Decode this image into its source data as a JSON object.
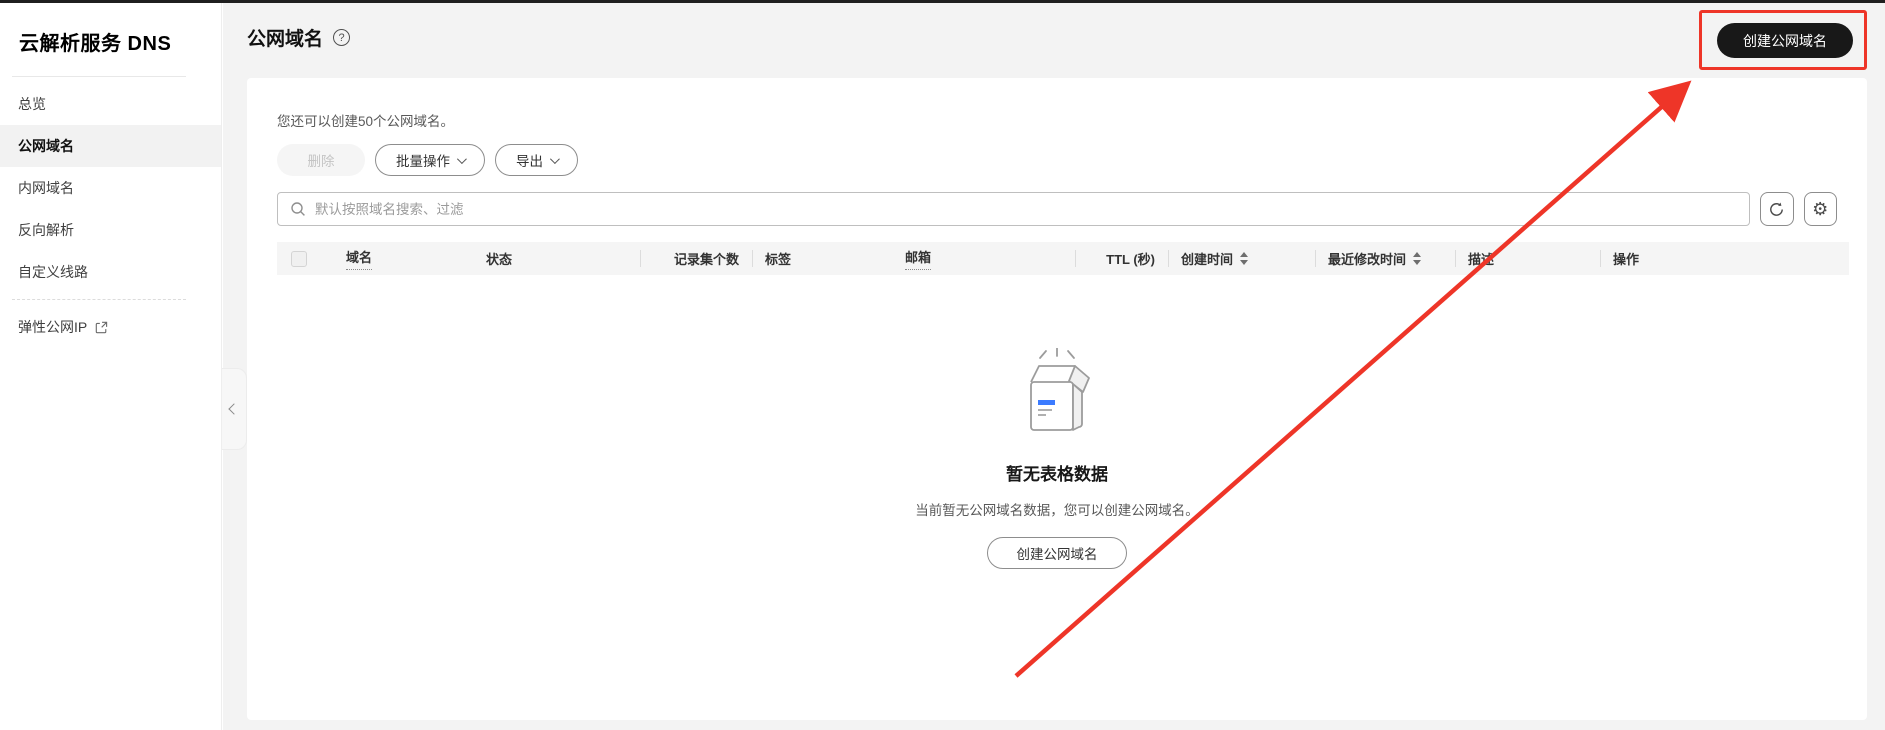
{
  "colors": {
    "annotation": "#ee3528",
    "accent_blue": "#3b7bff",
    "button_dark": "#181818"
  },
  "sidebar": {
    "title": "云解析服务 DNS",
    "items": [
      {
        "label": "总览",
        "selected": false
      },
      {
        "label": "公网域名",
        "selected": true
      },
      {
        "label": "内网域名",
        "selected": false
      },
      {
        "label": "反向解析",
        "selected": false
      },
      {
        "label": "自定义线路",
        "selected": false
      }
    ],
    "external_item": {
      "label": "弹性公网IP"
    }
  },
  "page": {
    "title": "公网域名",
    "help_icon": "?",
    "create_button_label": "创建公网域名"
  },
  "toolbar": {
    "quota_text": "您还可以创建50个公网域名。",
    "delete_label": "删除",
    "batch_label": "批量操作",
    "export_label": "导出"
  },
  "search": {
    "placeholder": "默认按照域名搜索、过滤"
  },
  "table": {
    "columns": [
      {
        "label": "域名",
        "dotted": true
      },
      {
        "label": "状态"
      },
      {
        "label": "记录集个数",
        "align": "right",
        "sep": true
      },
      {
        "label": "标签",
        "sep": true
      },
      {
        "label": "邮箱",
        "dotted": true
      },
      {
        "label": "TTL (秒)",
        "align": "right",
        "sep": true
      },
      {
        "label": "创建时间",
        "sortable": true,
        "sep": true
      },
      {
        "label": "最近修改时间",
        "sortable": true,
        "sep": true
      },
      {
        "label": "描述",
        "sep": true
      },
      {
        "label": "操作",
        "sep": true
      }
    ]
  },
  "empty_state": {
    "title": "暂无表格数据",
    "subtitle": "当前暂无公网域名数据，您可以创建公网域名。",
    "button_label": "创建公网域名"
  }
}
